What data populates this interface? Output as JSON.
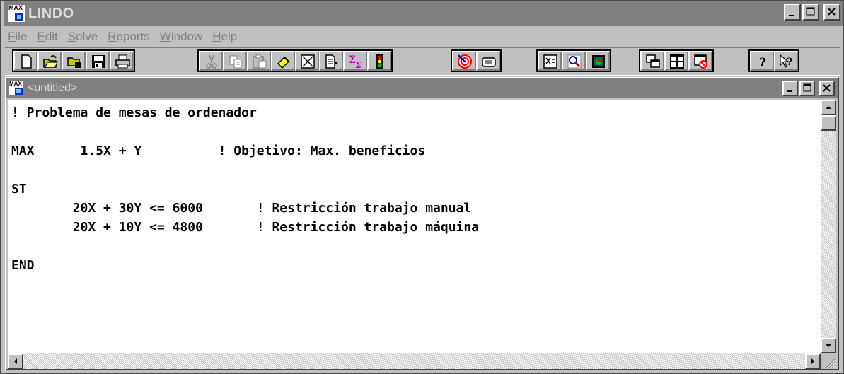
{
  "app": {
    "title": "LINDO",
    "icon_text": "MAX"
  },
  "menu": [
    {
      "label": "File",
      "mnemonic": "F"
    },
    {
      "label": "Edit",
      "mnemonic": "E"
    },
    {
      "label": "Solve",
      "mnemonic": "S"
    },
    {
      "label": "Reports",
      "mnemonic": "R"
    },
    {
      "label": "Window",
      "mnemonic": "W"
    },
    {
      "label": "Help",
      "mnemonic": "H"
    }
  ],
  "toolbar": {
    "groups": [
      [
        "new-file-icon",
        "open-file-icon",
        "view-file-icon",
        "save-icon",
        "print-icon"
      ],
      [
        "cut-icon",
        "copy-icon",
        "paste-icon",
        "clear-icon",
        "close-icon",
        "paste-symbol-icon",
        "sigma-icon",
        "traffic-light-icon"
      ],
      [
        "target-icon",
        "command-icon"
      ],
      [
        "formula-icon",
        "find-icon",
        "picture-icon"
      ],
      [
        "cascade-icon",
        "tile-icon",
        "close-all-icon"
      ],
      [
        "help-icon",
        "context-help-icon"
      ]
    ]
  },
  "child_window": {
    "title": "<untitled>",
    "icon_text": "MAX"
  },
  "editor": {
    "lines": [
      "! Problema de mesas de ordenador",
      "",
      "MAX      1.5X + Y          ! Objetivo: Max. beneficios",
      "",
      "ST",
      "        20X + 30Y <= 6000       ! Restricción trabajo manual",
      "        20X + 10Y <= 4800       ! Restricción trabajo máquina",
      "",
      "END"
    ]
  },
  "colors": {
    "titlebar_inactive": "#808080",
    "face": "#c0c0c0",
    "window": "#ffffff"
  }
}
